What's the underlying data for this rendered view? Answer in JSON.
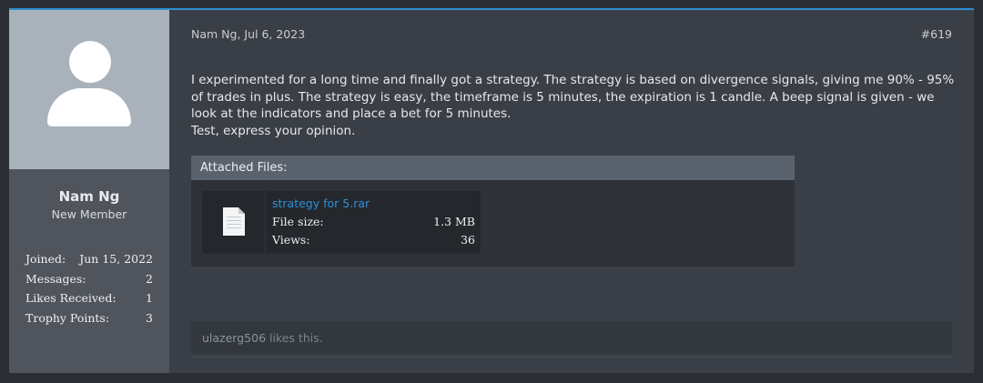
{
  "user": {
    "name": "Nam Ng",
    "title": "New Member",
    "stats": [
      {
        "label": "Joined:",
        "value": "Jun 15, 2022"
      },
      {
        "label": "Messages:",
        "value": "2"
      },
      {
        "label": "Likes Received:",
        "value": "1"
      },
      {
        "label": "Trophy Points:",
        "value": "3"
      }
    ]
  },
  "post": {
    "meta": "Nam Ng, Jul 6, 2023",
    "number": "#619",
    "body_line1": "I experimented for a long time and finally got a strategy. The strategy is based on divergence signals, giving me 90% - 95% of trades in plus. The strategy is easy, the timeframe is 5 minutes, the expiration is 1 candle. A beep signal is given - we look at the indicators and place a bet for 5 minutes.",
    "body_line2": "Test, express your opinion."
  },
  "attachments": {
    "header": "Attached Files:",
    "file": {
      "name": "strategy for 5.rar",
      "size_label": "File size:",
      "size": "1.3 MB",
      "views_label": "Views:",
      "views": "36",
      "icon": "document-icon"
    }
  },
  "likes": {
    "user": "ulazerg506",
    "suffix": " likes this."
  },
  "colors": {
    "accent": "#2f8fd6",
    "avatar_bg": "#a9b1ba",
    "panel": "#3a3f47",
    "sidebar": "#50555d"
  }
}
